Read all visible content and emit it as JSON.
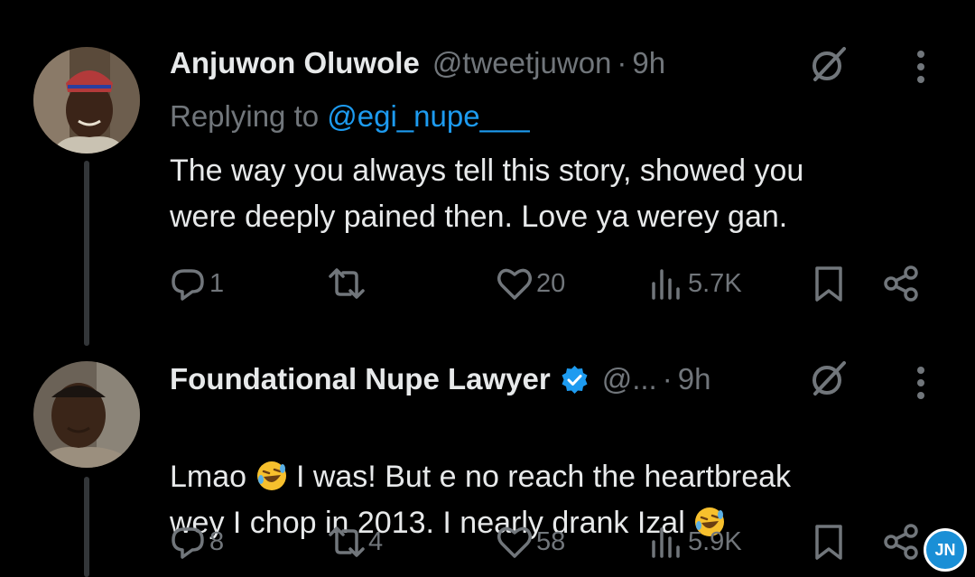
{
  "tweets": [
    {
      "name": "Anjuwon Oluwole",
      "handle": "@tweetjuwon",
      "dot": "·",
      "time": "9h",
      "replying_prefix": "Replying to ",
      "replying_mention": "@egi_nupe___",
      "text": "The way you always tell this story, showed you\nwere deeply pained then. Love ya werey gan.",
      "replies": "1",
      "reposts": "",
      "likes": "20",
      "views": "5.7K"
    },
    {
      "name": "Foundational Nupe Lawyer",
      "handle": "@...",
      "dot": "·",
      "time": "9h",
      "verified": true,
      "text_part1": "Lmao ",
      "text_part2": " I was! But e no reach the heartbreak\nwey I chop in 2013. I nearly drank Izal ",
      "replies": "8",
      "reposts": "4",
      "likes": "58",
      "views": "5.9K"
    }
  ],
  "watermark": "JN",
  "colors": {
    "background": "#000000",
    "text": "#e7e9ea",
    "muted": "#71767b",
    "link": "#1d9bf0",
    "verified": "#1d9bf0"
  },
  "icons": [
    "reply-icon",
    "repost-icon",
    "like-icon",
    "views-icon",
    "bookmark-icon",
    "share-icon",
    "grok-icon",
    "more-icon",
    "verified-icon",
    "rofl-emoji"
  ]
}
